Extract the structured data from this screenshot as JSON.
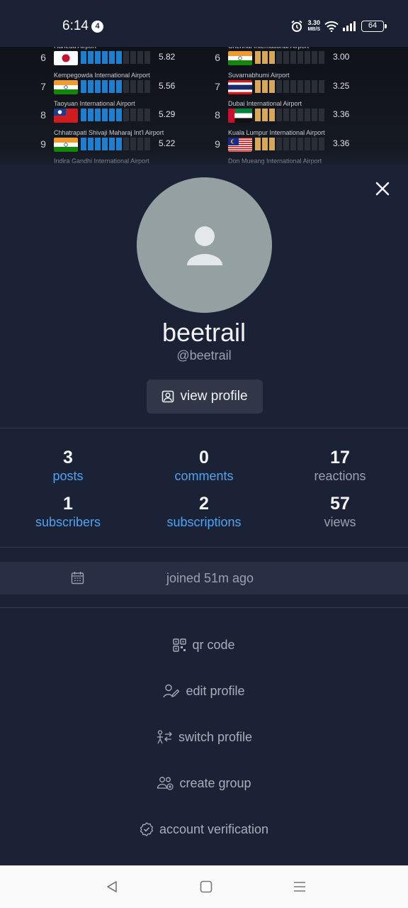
{
  "status_bar": {
    "time": "6:14",
    "notification_count": "4",
    "net_speed_value": "3.30",
    "net_speed_unit": "MB/S",
    "battery": "64"
  },
  "background_image": {
    "left_column": [
      {
        "name": "Haneda Airport",
        "rank": "6",
        "value": "5.82",
        "flag": "japan",
        "bars_filled": 6
      },
      {
        "name": "Kempegowda International Airport",
        "rank": "7",
        "value": "5.56",
        "flag": "india",
        "bars_filled": 6
      },
      {
        "name": "Taoyuan International Airport",
        "rank": "8",
        "value": "5.29",
        "flag": "taiwan",
        "bars_filled": 6
      },
      {
        "name": "Chhatrapati Shivaji Maharaj Int'l Airport",
        "rank": "9",
        "value": "5.22",
        "flag": "india",
        "bars_filled": 6
      },
      {
        "name": "Indira Gandhi International Airport",
        "rank": "",
        "value": "",
        "flag": "",
        "bars_filled": 0
      }
    ],
    "right_column": [
      {
        "name": "Chennai International Airport",
        "rank": "6",
        "value": "3.00",
        "flag": "india",
        "bars_filled": 3
      },
      {
        "name": "Suvarnabhumi Airport",
        "rank": "7",
        "value": "3.25",
        "flag": "thailand",
        "bars_filled": 3
      },
      {
        "name": "Dubai International Airport",
        "rank": "8",
        "value": "3.36",
        "flag": "uae",
        "bars_filled": 3
      },
      {
        "name": "Kuala Lumpur International Airport",
        "rank": "9",
        "value": "3.36",
        "flag": "malaysia",
        "bars_filled": 3
      },
      {
        "name": "Don Mueang International Airport",
        "rank": "",
        "value": "",
        "flag": "",
        "bars_filled": 0
      }
    ],
    "colors": {
      "left_bars": "#1e7fd0",
      "right_bars": "#d8a85a"
    }
  },
  "profile": {
    "username": "beetrail",
    "handle": "@beetrail",
    "view_profile_label": "view profile"
  },
  "stats": [
    {
      "value": "3",
      "label": "posts",
      "is_link": true
    },
    {
      "value": "0",
      "label": "comments",
      "is_link": true
    },
    {
      "value": "17",
      "label": "reactions",
      "is_link": false
    },
    {
      "value": "1",
      "label": "subscribers",
      "is_link": true
    },
    {
      "value": "2",
      "label": "subscriptions",
      "is_link": true
    },
    {
      "value": "57",
      "label": "views",
      "is_link": false
    }
  ],
  "joined": {
    "text": "joined 51m ago",
    "icon": "calendar-icon"
  },
  "menu": {
    "qr_code": "qr code",
    "edit_profile": "edit profile",
    "switch_profile": "switch profile",
    "create_group": "create group",
    "account_verification": "account verification"
  },
  "colors": {
    "background": "#1c2236",
    "accent_link": "#4fa3ef",
    "avatar": "#95a0a3"
  }
}
